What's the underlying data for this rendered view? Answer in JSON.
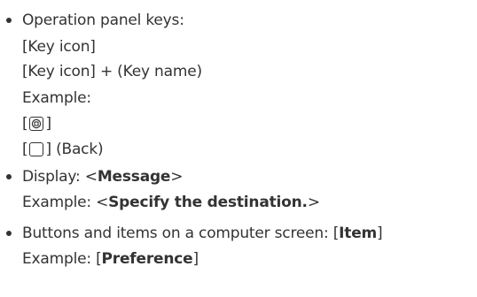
{
  "items": [
    {
      "bullet": "Operation panel keys:",
      "lines": [
        "[Key icon]",
        "[Key icon] + (Key name)",
        "Example:"
      ],
      "examples": [
        {
          "open": "[",
          "icon": "stop-icon",
          "close": "]"
        },
        {
          "open": "[",
          "icon": "back-key-icon",
          "close": "] (Back)"
        }
      ]
    },
    {
      "bullet": "Display: <",
      "bold": "Message",
      "after": ">",
      "example_prefix": "Example: <",
      "example_bold": "Specify the destination.",
      "example_suffix": ">"
    },
    {
      "bullet": "Buttons and items on a computer screen: [",
      "bold": "Item",
      "after": "]",
      "example_prefix": "Example: [",
      "example_bold": "Preference",
      "example_suffix": "]"
    }
  ]
}
